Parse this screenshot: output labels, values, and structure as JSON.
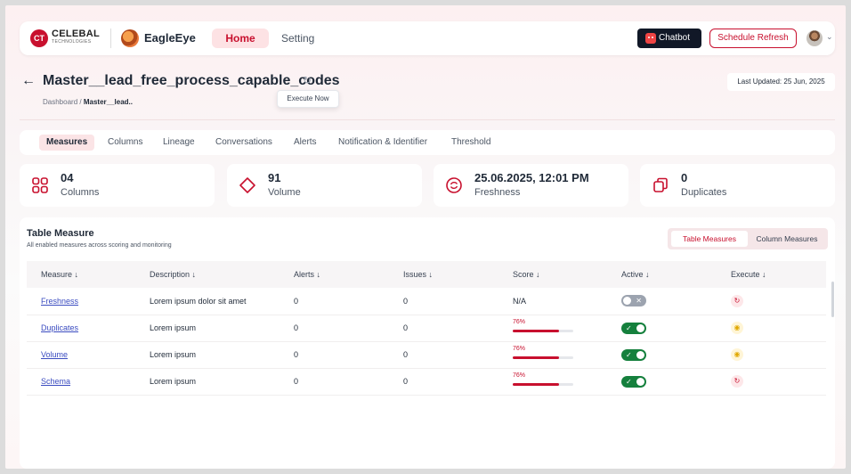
{
  "nav": {
    "brand_name": "CELEBAL",
    "brand_sub": "TECHNOLOGIES",
    "brand_mark": "CT",
    "app_name": "EagleEye",
    "home_label": "Home",
    "setting_label": "Setting",
    "chatbot_label": "Chatbot",
    "schedule_label": "Schedule Refresh"
  },
  "header": {
    "title": "Master__lead_free_process_capable_codes",
    "tooltip": "Execute Now",
    "breadcrumb_root": "Dashboard",
    "breadcrumb_sep": "/",
    "breadcrumb_current": "Master__lead..",
    "last_updated": "Last Updated: 25 Jun, 2025"
  },
  "tabs": [
    "Measures",
    "Columns",
    "Lineage",
    "Conversations",
    "Alerts",
    "Notification & Identifier",
    "Threshold"
  ],
  "active_tab": "Measures",
  "stats": [
    {
      "value": "04",
      "label": "Columns",
      "icon": "grid-icon"
    },
    {
      "value": "91",
      "label": "Volume",
      "icon": "diamond-icon"
    },
    {
      "value": "25.06.2025, 12:01 PM",
      "label": "Freshness",
      "icon": "refresh-circle-icon"
    },
    {
      "value": "0",
      "label": "Duplicates",
      "icon": "duplicate-icon"
    }
  ],
  "panel": {
    "title": "Table Measure",
    "subtitle": "All enabled measures across scoring and monitoring",
    "seg_active": "Table Measures",
    "seg_inactive": "Column Measures"
  },
  "table": {
    "headers": [
      "Measure ↓",
      "Description ↓",
      "Alerts ↓",
      "Issues ↓",
      "Score ↓",
      "Active ↓",
      "Execute ↓"
    ],
    "rows": [
      {
        "measure": "Freshness",
        "description": "Lorem ipsum dolor sit amet",
        "alerts": "0",
        "issues": "0",
        "score": "N/A",
        "score_value": null,
        "active": false,
        "execute": "refresh"
      },
      {
        "measure": "Duplicates",
        "description": "Lorem ipsum",
        "alerts": "0",
        "issues": "0",
        "score": "76%",
        "score_value": 0.76,
        "active": true,
        "execute": "pending"
      },
      {
        "measure": "Volume",
        "description": "Lorem ipsum",
        "alerts": "0",
        "issues": "0",
        "score": "76%",
        "score_value": 0.76,
        "active": true,
        "execute": "pending"
      },
      {
        "measure": "Schema",
        "description": "Lorem ipsum",
        "alerts": "0",
        "issues": "0",
        "score": "76%",
        "score_value": 0.76,
        "active": true,
        "execute": "refresh"
      }
    ]
  },
  "colors": {
    "brand": "#c8102e",
    "active_toggle": "#15803d",
    "inactive_toggle": "#9ca3af",
    "link": "#3b4cc0"
  }
}
